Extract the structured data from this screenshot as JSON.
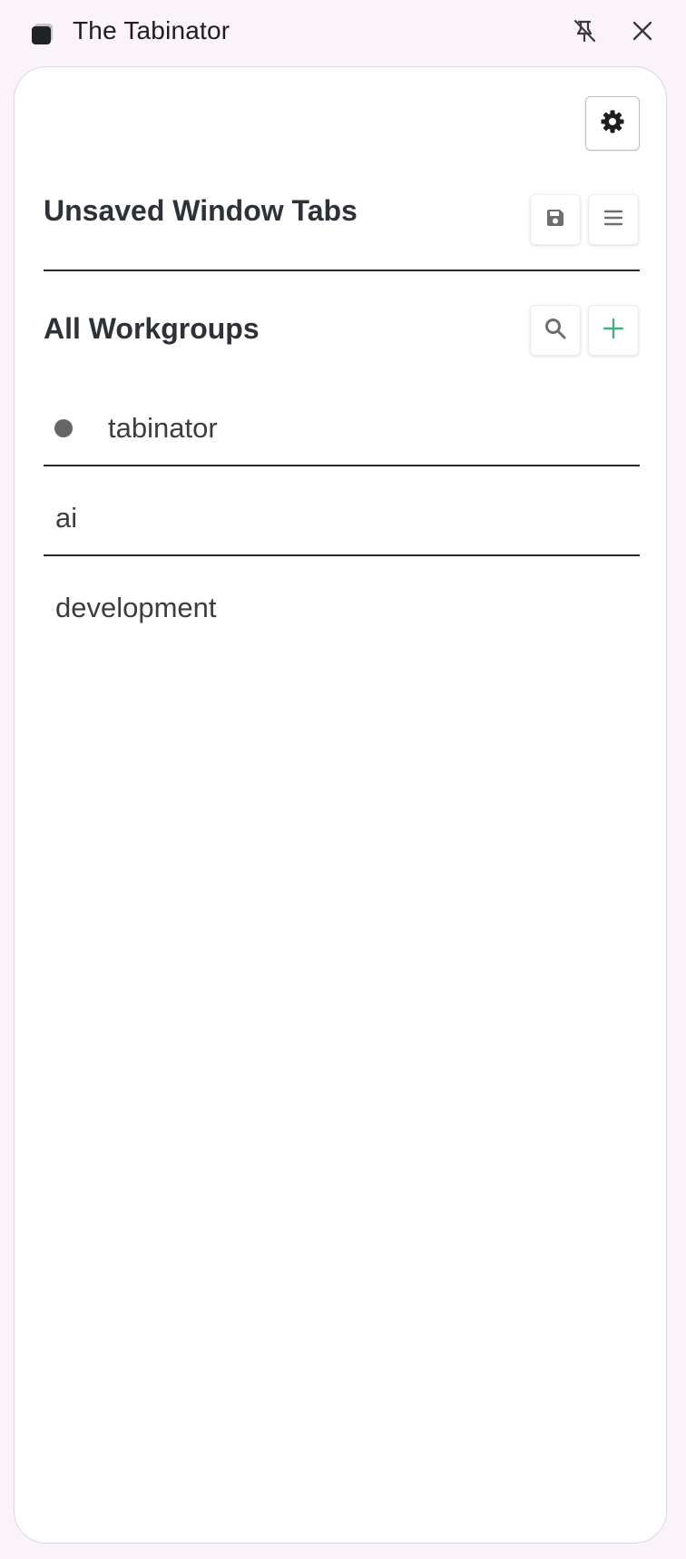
{
  "titlebar": {
    "title": "The Tabinator",
    "app_icon": "tabinator-app-icon",
    "unpin_icon": "unpin-icon",
    "close_icon": "close-icon"
  },
  "toolbar": {
    "settings_icon": "gear-icon"
  },
  "unsaved": {
    "title": "Unsaved Window Tabs",
    "save_icon": "floppy-disk-icon",
    "menu_icon": "hamburger-menu-icon"
  },
  "workgroups": {
    "title": "All Workgroups",
    "search_icon": "search-icon",
    "add_icon": "plus-icon",
    "items": [
      {
        "label": "tabinator",
        "active": true
      },
      {
        "label": "ai",
        "active": false
      },
      {
        "label": "development",
        "active": false
      }
    ]
  },
  "colors": {
    "background": "#fbf3fa",
    "panel": "#ffffff",
    "text": "#2e3138",
    "accent_add": "#45b07f",
    "icon_gray": "#6e6e6e",
    "active_dot": "#666666"
  }
}
